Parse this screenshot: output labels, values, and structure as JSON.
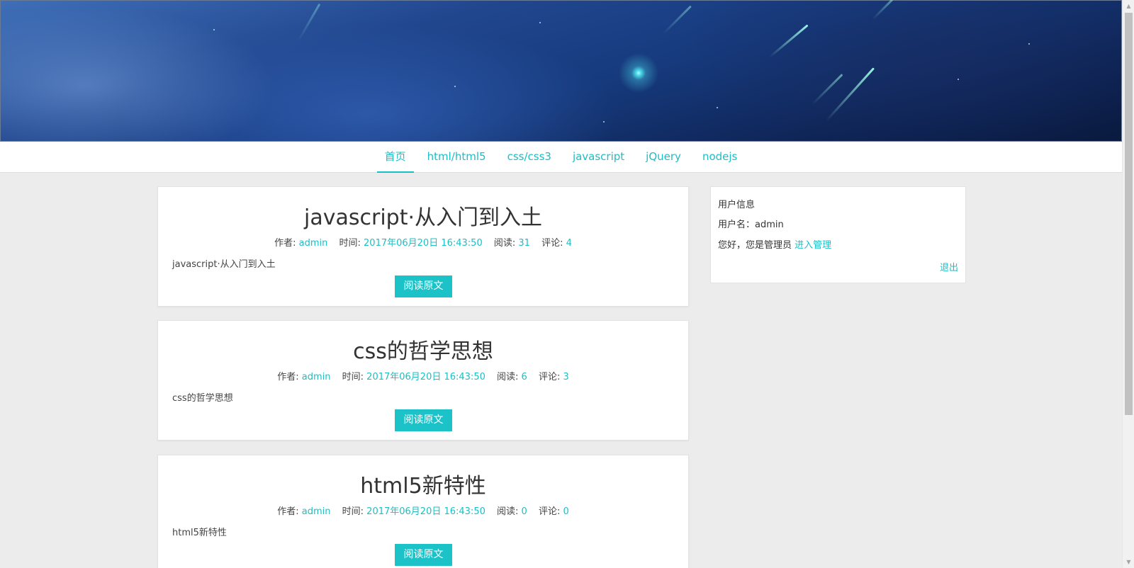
{
  "nav": {
    "items": [
      {
        "label": "首页",
        "active": true
      },
      {
        "label": "html/html5",
        "active": false
      },
      {
        "label": "css/css3",
        "active": false
      },
      {
        "label": "javascript",
        "active": false
      },
      {
        "label": "jQuery",
        "active": false
      },
      {
        "label": "nodejs",
        "active": false
      }
    ]
  },
  "meta_labels": {
    "author": "作者:",
    "time": "时间:",
    "reads": "阅读:",
    "comments": "评论:"
  },
  "articles": [
    {
      "title": "javascript·从入门到入土",
      "author": "admin",
      "time": "2017年06月20日 16:43:50",
      "reads": "31",
      "comments": "4",
      "summary": "javascript·从入门到入土",
      "button": "阅读原文"
    },
    {
      "title": "css的哲学思想",
      "author": "admin",
      "time": "2017年06月20日 16:43:50",
      "reads": "6",
      "comments": "3",
      "summary": "css的哲学思想",
      "button": "阅读原文"
    },
    {
      "title": "html5新特性",
      "author": "admin",
      "time": "2017年06月20日 16:43:50",
      "reads": "0",
      "comments": "0",
      "summary": "html5新特性",
      "button": "阅读原文"
    }
  ],
  "user_panel": {
    "heading": "用户信息",
    "username_label": "用户名：",
    "username": "admin",
    "greeting": "您好，您是管理员",
    "admin_link": "进入管理",
    "logout": "退出"
  },
  "colors": {
    "accent": "#1bbfc5",
    "button": "#1bc3c9",
    "background": "#ececec"
  }
}
